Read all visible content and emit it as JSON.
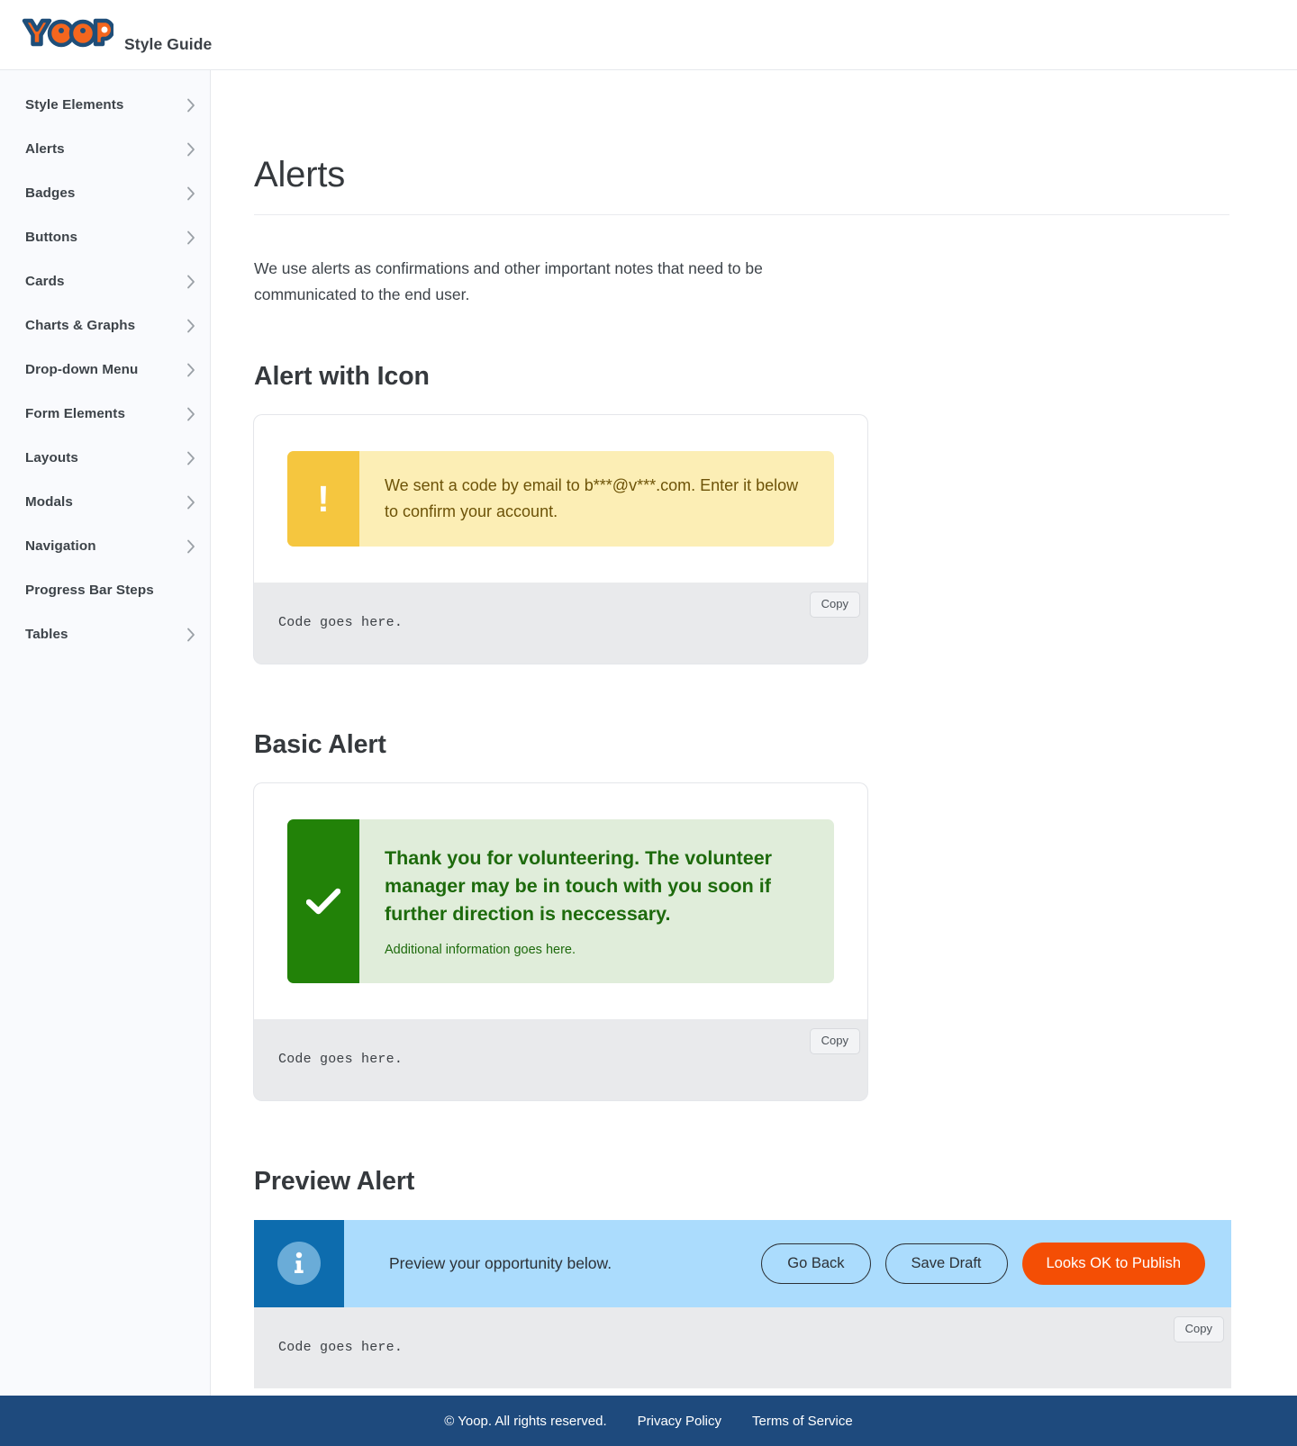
{
  "header": {
    "logo_text": "YOOP",
    "title": "Style Guide",
    "logo_fill": "#F4661E",
    "logo_stroke": "#1F4E79"
  },
  "sidebar": {
    "items": [
      {
        "label": "Style Elements",
        "chevron": true
      },
      {
        "label": "Alerts",
        "chevron": true
      },
      {
        "label": "Badges",
        "chevron": true
      },
      {
        "label": "Buttons",
        "chevron": true
      },
      {
        "label": "Cards",
        "chevron": true
      },
      {
        "label": "Charts & Graphs",
        "chevron": true
      },
      {
        "label": "Drop-down Menu",
        "chevron": true
      },
      {
        "label": "Form Elements",
        "chevron": true
      },
      {
        "label": "Layouts",
        "chevron": true
      },
      {
        "label": "Modals",
        "chevron": true
      },
      {
        "label": "Navigation",
        "chevron": true
      },
      {
        "label": "Progress Bar Steps",
        "chevron": false
      },
      {
        "label": "Tables",
        "chevron": true
      }
    ]
  },
  "main": {
    "page_title": "Alerts",
    "intro": "We use alerts as confirmations and other important notes that need to be communicated to the end user.",
    "sections": [
      {
        "title": "Alert with Icon",
        "alert": {
          "kind": "warning",
          "icon": "exclamation-icon",
          "icon_glyph": "!",
          "message": "We sent a code by email to b***@v***.com. Enter it below to confirm your account.",
          "bar_color": "#F5C63F",
          "bg_color": "#FCEEB5",
          "text_color": "#6D5308"
        },
        "code": {
          "text": "Code goes here.",
          "copy_label": "Copy"
        }
      },
      {
        "title": "Basic Alert",
        "alert": {
          "kind": "success",
          "icon": "check-icon",
          "title": "Thank you for volunteering. The volunteer manager may be in touch with you soon if further direction is neccessary.",
          "subtitle": "Additional information goes here.",
          "bar_color": "#228208",
          "bg_color": "#E0EDDA",
          "text_color": "#1D6A0C"
        },
        "code": {
          "text": "Code goes here.",
          "copy_label": "Copy"
        }
      },
      {
        "title": "Preview Alert",
        "alert": {
          "kind": "info",
          "icon": "info-icon",
          "message": "Preview your opportunity below.",
          "bar_color": "#0D6CAE",
          "bg_color": "#ABDCFD",
          "buttons": [
            {
              "label": "Go Back",
              "style": "outline"
            },
            {
              "label": "Save Draft",
              "style": "outline"
            },
            {
              "label": "Looks OK to Publish",
              "style": "primary",
              "color": "#F44E05"
            }
          ]
        },
        "code": {
          "text": "Code goes here.",
          "copy_label": "Copy"
        }
      }
    ]
  },
  "footer": {
    "copyright": "© Yoop. All rights reserved.",
    "links": [
      "Privacy Policy",
      "Terms of Service"
    ],
    "bg_color": "#1E4A7D"
  }
}
